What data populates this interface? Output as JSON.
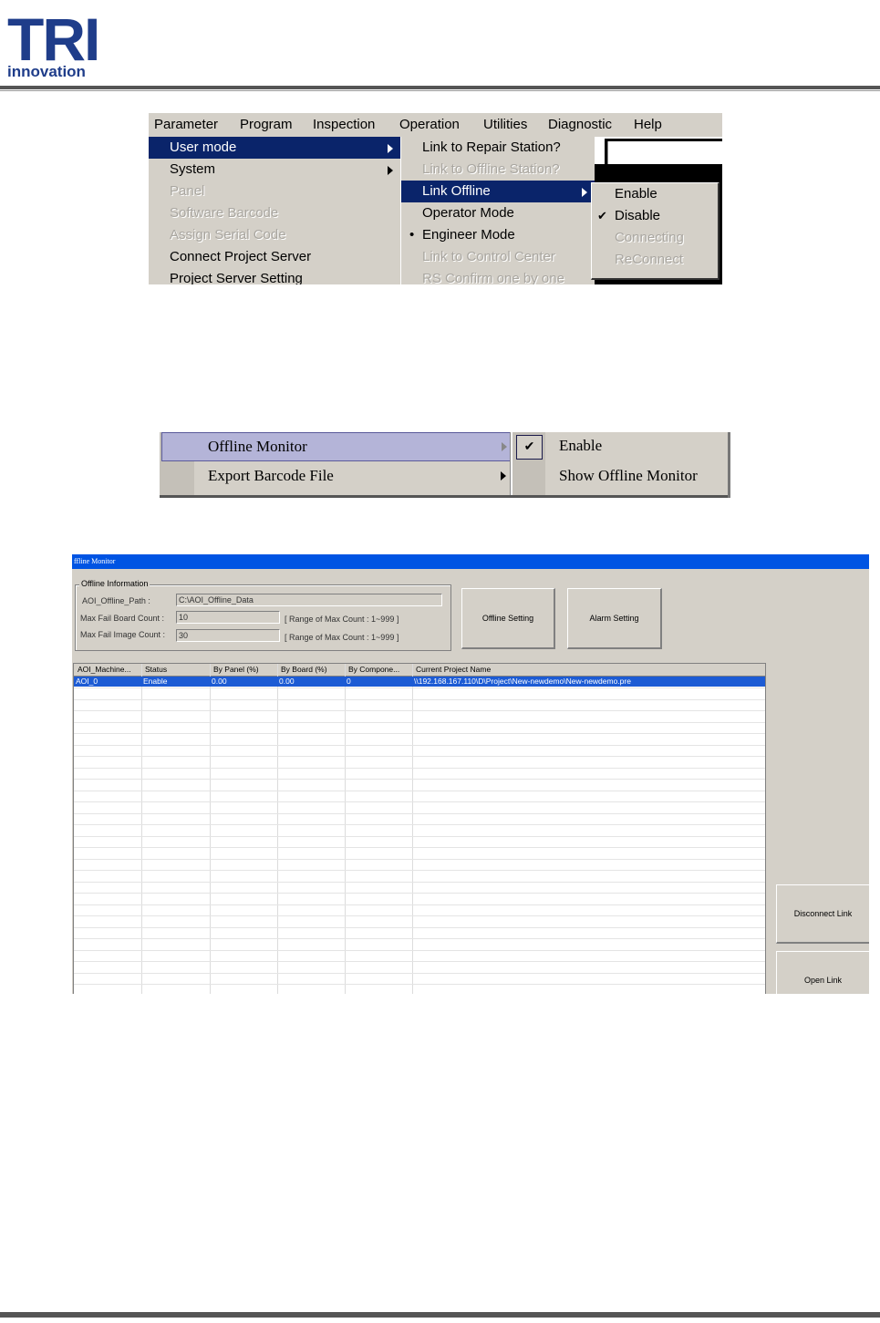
{
  "logo": {
    "mark": "TRI",
    "word": "innovation"
  },
  "shot1": {
    "menubar": [
      "Parameter",
      "Program",
      "Inspection",
      "Operation",
      "Utilities",
      "Diagnostic",
      "Help"
    ],
    "parameter_menu": [
      {
        "label": "User mode",
        "selected": true,
        "submenu": true
      },
      {
        "label": "System",
        "submenu": true
      },
      {
        "label": "Panel",
        "disabled": true
      },
      {
        "label": "Software Barcode",
        "disabled": true
      },
      {
        "label": "Assign Serial Code",
        "disabled": true
      },
      {
        "label": "Connect Project Server"
      },
      {
        "label": "Project Server Setting"
      }
    ],
    "user_mode_menu": [
      {
        "label": "Link to Repair Station?"
      },
      {
        "label": "Link to Offline Station?",
        "disabled": true
      },
      {
        "label": "Link Offline",
        "selected": true,
        "submenu": true
      },
      {
        "label": "Operator Mode"
      },
      {
        "label": "Engineer Mode",
        "bullet": true
      },
      {
        "label": "Link to Control Center",
        "disabled": true
      },
      {
        "label": "RS Confirm one by one",
        "disabled": true
      }
    ],
    "link_offline_menu": [
      {
        "label": "Enable"
      },
      {
        "label": "Disable",
        "checked": true
      },
      {
        "label": "Connecting",
        "disabled": true
      },
      {
        "label": "ReConnect",
        "disabled": true
      }
    ]
  },
  "shot2": {
    "items": [
      {
        "label": "Offline Monitor",
        "selected": true,
        "submenu": true
      },
      {
        "label": "Export Barcode File",
        "submenu": true
      }
    ],
    "submenu": [
      {
        "label": "Enable",
        "checked": true
      },
      {
        "label": "Show Offline Monitor"
      }
    ]
  },
  "shot3": {
    "title": "ffline Monitor",
    "group_label": "Offline Information",
    "path_label": "AOI_Offline_Path :",
    "path_value": "C:\\AOI_Offline_Data",
    "max_board_label": "Max Fail Board Count :",
    "max_board_value": "10",
    "max_board_range": "[ Range of Max Count : 1~999 ]",
    "max_image_label": "Max Fail Image Count :",
    "max_image_value": "30",
    "max_image_range": "[ Range of Max Count : 1~999 ]",
    "offline_setting_btn": "Offline Setting",
    "alarm_setting_btn": "Alarm Setting",
    "disconnect_btn": "Disconnect Link",
    "open_btn": "Open Link",
    "columns": [
      "AOI_Machine...",
      "Status",
      "By Panel (%)",
      "By Board (%)",
      "By Compone...",
      "Current Project Name"
    ],
    "row": [
      "AOI_0",
      "Enable",
      "0.00",
      "0.00",
      "0",
      "\\\\192.168.167.110\\D\\Project\\New-newdemo\\New-newdemo.pre"
    ]
  }
}
